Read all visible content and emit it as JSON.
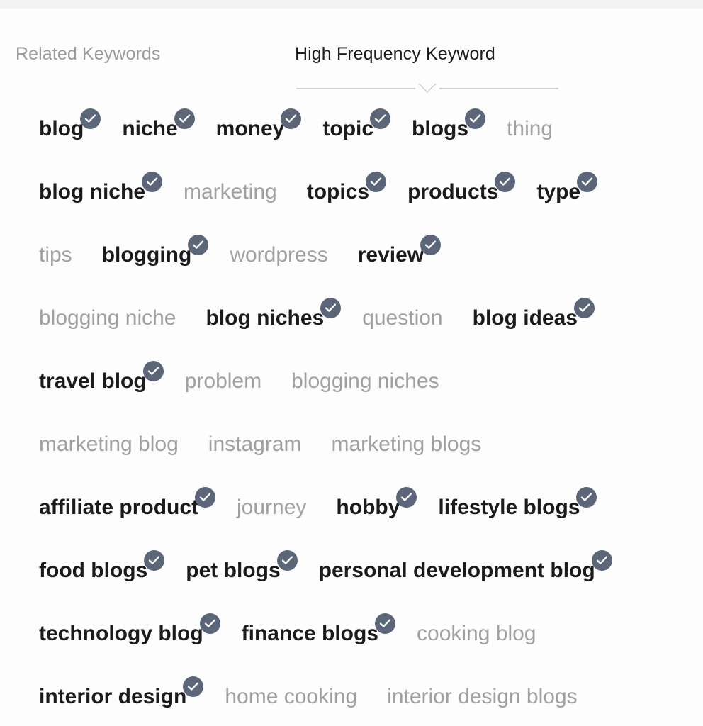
{
  "theme": {
    "page_background": "#f2f3f4",
    "card_background": "#fdfdfd",
    "selected_text_color": "#1b1b1d",
    "unselected_text_color": "#9fa0a2",
    "badge_color": "#5c6679",
    "badge_check_color": "#ffffff",
    "active_tab_color": "#1d1d1f",
    "inactive_tab_color": "#9b9b9d",
    "underline_color": "#cfcfd1"
  },
  "tabs": [
    {
      "id": "related-keywords",
      "label": "Related Keywords",
      "active": false
    },
    {
      "id": "high-frequency-keyword",
      "label": "High Frequency Keyword",
      "active": true
    }
  ],
  "badge_icon": "check-icon",
  "keyword_rows": [
    [
      {
        "text": "blog",
        "selected": true
      },
      {
        "text": "niche",
        "selected": true
      },
      {
        "text": "money",
        "selected": true
      },
      {
        "text": "topic",
        "selected": true
      },
      {
        "text": "blogs",
        "selected": true
      },
      {
        "text": "thing",
        "selected": false
      }
    ],
    [
      {
        "text": "blog niche",
        "selected": true
      },
      {
        "text": "marketing",
        "selected": false
      },
      {
        "text": "topics",
        "selected": true
      },
      {
        "text": "products",
        "selected": true
      },
      {
        "text": "type",
        "selected": true
      }
    ],
    [
      {
        "text": "tips",
        "selected": false
      },
      {
        "text": "blogging",
        "selected": true
      },
      {
        "text": "wordpress",
        "selected": false
      },
      {
        "text": "review",
        "selected": true
      }
    ],
    [
      {
        "text": "blogging niche",
        "selected": false
      },
      {
        "text": "blog niches",
        "selected": true
      },
      {
        "text": "question",
        "selected": false
      },
      {
        "text": "blog ideas",
        "selected": true
      }
    ],
    [
      {
        "text": "travel blog",
        "selected": true
      },
      {
        "text": "problem",
        "selected": false
      },
      {
        "text": "blogging niches",
        "selected": false
      }
    ],
    [
      {
        "text": "marketing blog",
        "selected": false
      },
      {
        "text": "instagram",
        "selected": false
      },
      {
        "text": "marketing blogs",
        "selected": false
      }
    ],
    [
      {
        "text": "affiliate product",
        "selected": true
      },
      {
        "text": "journey",
        "selected": false
      },
      {
        "text": "hobby",
        "selected": true
      },
      {
        "text": "lifestyle blogs",
        "selected": true
      }
    ],
    [
      {
        "text": "food blogs",
        "selected": true
      },
      {
        "text": "pet blogs",
        "selected": true
      },
      {
        "text": "personal development blog",
        "selected": true
      }
    ],
    [
      {
        "text": "technology blog",
        "selected": true
      },
      {
        "text": "finance blogs",
        "selected": true
      },
      {
        "text": "cooking blog",
        "selected": false
      }
    ],
    [
      {
        "text": "interior design",
        "selected": true
      },
      {
        "text": "home cooking",
        "selected": false
      },
      {
        "text": "interior design blogs",
        "selected": false
      }
    ]
  ]
}
